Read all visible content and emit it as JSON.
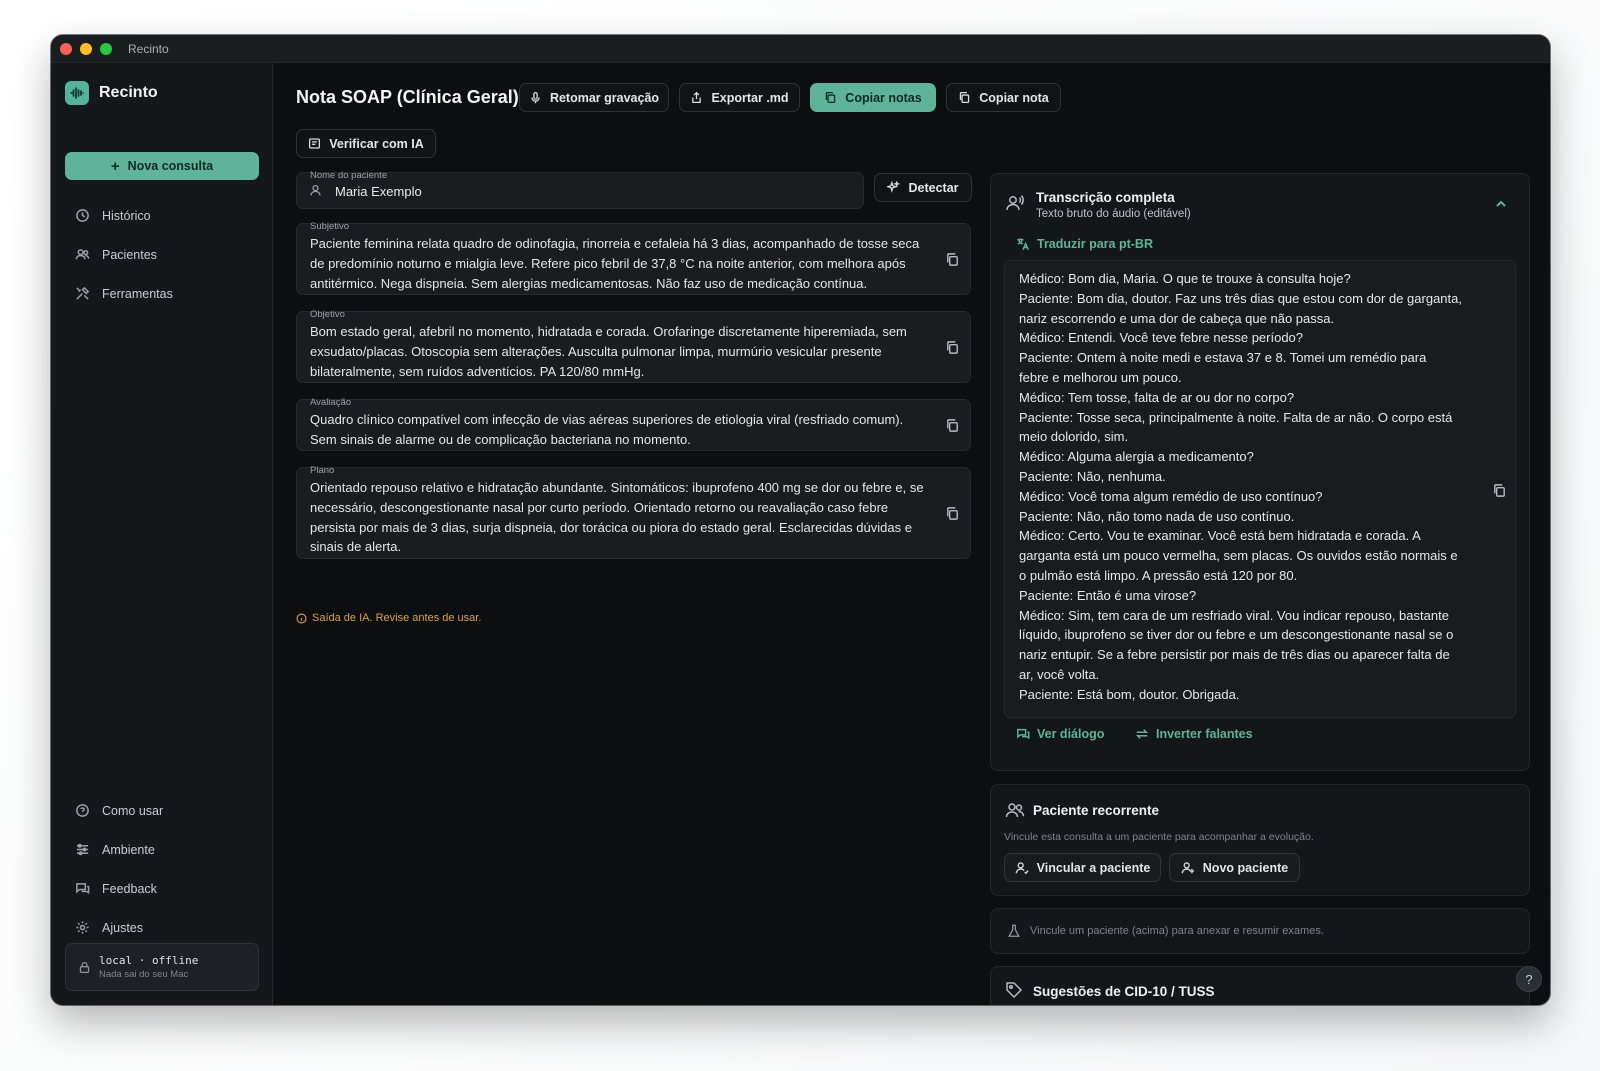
{
  "window": {
    "title": "Recinto"
  },
  "sidebar": {
    "brand": "Recinto",
    "new_button": "Nova consulta",
    "items": [
      {
        "label": "Histórico",
        "icon": "history-icon"
      },
      {
        "label": "Pacientes",
        "icon": "users-icon"
      },
      {
        "label": "Ferramentas",
        "icon": "tools-icon"
      }
    ],
    "bottom_items": [
      {
        "label": "Como usar",
        "icon": "help-icon"
      },
      {
        "label": "Ambiente",
        "icon": "sliders-icon"
      },
      {
        "label": "Feedback",
        "icon": "chat-icon"
      },
      {
        "label": "Ajustes",
        "icon": "gear-icon"
      }
    ],
    "status": {
      "main": "local · offline",
      "sub": "Nada sai do seu Mac"
    }
  },
  "header": {
    "title": "Nota SOAP (Clínica Geral)",
    "buttons": {
      "resume": "Retomar gravação",
      "export": "Exportar .md",
      "copy_notes": "Copiar notas",
      "copy_note": "Copiar nota",
      "verify": "Verificar com IA"
    }
  },
  "patient": {
    "label": "Nome do paciente",
    "value": "Maria Exemplo",
    "detect": "Detectar"
  },
  "soap": {
    "subjetivo": {
      "label": "Subjetivo",
      "text": "Paciente feminina relata quadro de odinofagia, rinorreia e cefaleia há 3 dias, acompanhado de tosse seca de predomínio noturno e mialgia leve. Refere pico febril de 37,8 °C na noite anterior, com melhora após antitérmico. Nega dispneia. Sem alergias medicamentosas. Não faz uso de medicação contínua."
    },
    "objetivo": {
      "label": "Objetivo",
      "text": "Bom estado geral, afebril no momento, hidratada e corada. Orofaringe discretamente hiperemiada, sem exsudato/placas. Otoscopia sem alterações. Ausculta pulmonar limpa, murmúrio vesicular presente bilateralmente, sem ruídos adventícios. PA 120/80 mmHg."
    },
    "avaliacao": {
      "label": "Avaliação",
      "text": "Quadro clínico compatível com infecção de vias aéreas superiores de etiologia viral (resfriado comum). Sem sinais de alarme ou de complicação bacteriana no momento."
    },
    "plano": {
      "label": "Plano",
      "text": "Orientado repouso relativo e hidratação abundante. Sintomáticos: ibuprofeno 400 mg se dor ou febre e, se necessário, descongestionante nasal por curto período. Orientado retorno ou reavaliação caso febre persista por mais de 3 dias, surja dispneia, dor torácica ou piora do estado geral. Esclarecidas dúvidas e sinais de alerta."
    },
    "warning": "Saída de IA. Revise antes de usar."
  },
  "transcript": {
    "title": "Transcrição completa",
    "subtitle": "Texto bruto do áudio (editável)",
    "translate": "Traduzir para pt-BR",
    "lines": [
      "Médico: Bom dia, Maria. O que te trouxe à consulta hoje?",
      "Paciente: Bom dia, doutor. Faz uns três dias que estou com dor de garganta,",
      "nariz escorrendo e uma dor de cabeça que não passa.",
      "Médico: Entendi. Você teve febre nesse período?",
      "Paciente: Ontem à noite medi e estava 37 e 8. Tomei um remédio para",
      "febre e melhorou um pouco.",
      "Médico: Tem tosse, falta de ar ou dor no corpo?",
      "Paciente: Tosse seca, principalmente à noite. Falta de ar não. O corpo está",
      "meio dolorido, sim.",
      "Médico: Alguma alergia a medicamento?",
      "Paciente: Não, nenhuma.",
      "Médico: Você toma algum remédio de uso contínuo?",
      "Paciente: Não, não tomo nada de uso contínuo.",
      "Médico: Certo. Vou te examinar. Você está bem hidratada e corada. A",
      "garganta está um pouco vermelha, sem placas. Os ouvidos estão normais e",
      "o pulmão está limpo. A pressão está 120 por 80.",
      "Paciente: Então é uma virose?",
      "Médico: Sim, tem cara de um resfriado viral. Vou indicar repouso, bastante",
      "líquido, ibuprofeno se tiver dor ou febre e um descongestionante nasal se o",
      "nariz entupir. Se a febre persistir por mais de três dias ou aparecer falta de",
      "ar, você volta.",
      "Paciente: Está bom, doutor. Obrigada."
    ],
    "view_dialog": "Ver diálogo",
    "swap_speakers": "Inverter falantes"
  },
  "recurring": {
    "title": "Paciente recorrente",
    "desc": "Vincule esta consulta a um paciente para acompanhar a evolução.",
    "link_button": "Vincular a paciente",
    "new_button": "Novo paciente"
  },
  "exams": {
    "text": "Vincule um paciente (acima) para anexar e resumir exames."
  },
  "cid": {
    "title": "Sugestões de CID-10 / TUSS"
  },
  "colors": {
    "accent": "#5fb39b",
    "warning": "#d7a24c",
    "background": "#0c0e10"
  }
}
